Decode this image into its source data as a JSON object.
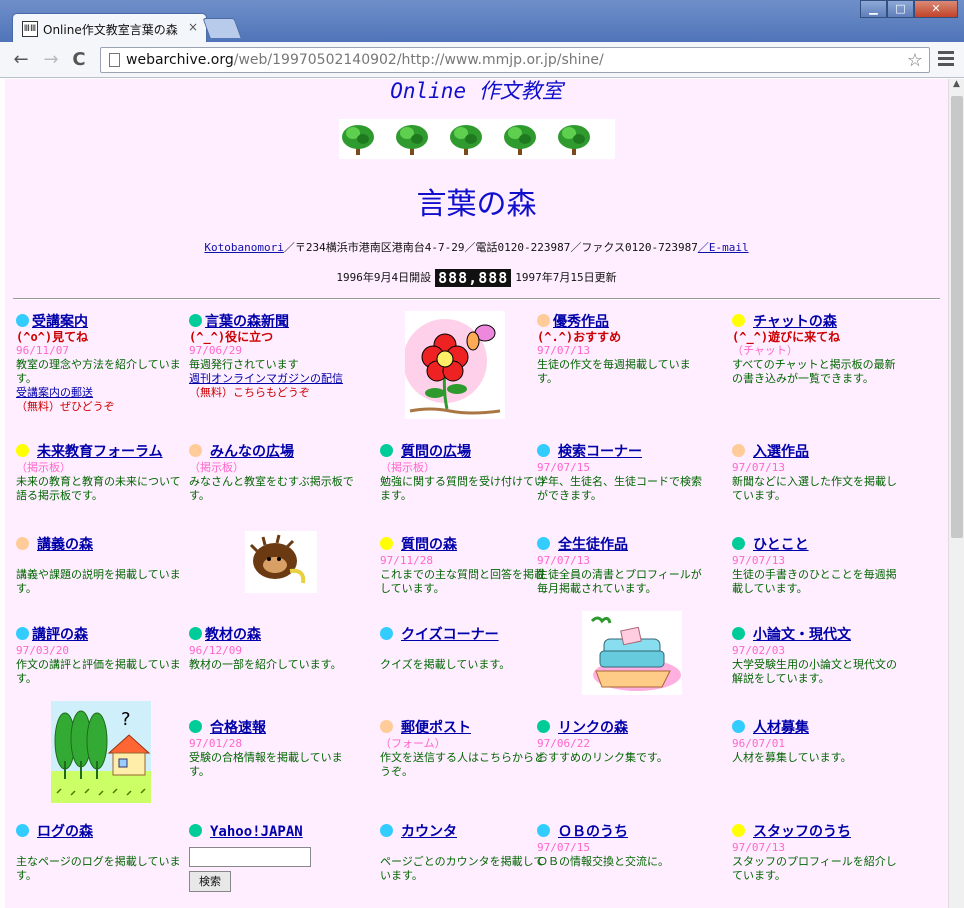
{
  "browser": {
    "tab_title": "Online作文教室言葉の森",
    "tab_close": "×",
    "url_host": "webarchive.org",
    "url_path": "/web/19970502140902/http://www.mmjp.or.jp/shine/",
    "back": "←",
    "forward": "→",
    "reload": "C",
    "star": "☆",
    "min": "▁",
    "max": "□",
    "close": "✕"
  },
  "page": {
    "site_title": "Online 作文教室",
    "main_title": "言葉の森",
    "address_link": "Kotobanomori",
    "address_text": "／〒234横浜市港南区港南台4-7-29／電話0120-223987／ファクス0120-723987",
    "email_link": "／E-mail",
    "opened": "1996年9月4日開設",
    "counter": "888,888",
    "updated": "1997年7月15日更新"
  },
  "colors": {
    "page_bg": "#ffeeff",
    "link": "#0000aa",
    "desc": "#006600",
    "date": "#ff66cc",
    "accent_red": "#cc0000",
    "dot_blue": "#33ccff",
    "dot_green": "#00cc99",
    "dot_peach": "#ffcc99",
    "dot_yellow": "#ffff00"
  },
  "grid": [
    {
      "title": "受講案内",
      "tag": "(^o^)見てね",
      "date": "96/11/07",
      "desc": "教室の理念や方法を紹介しています。",
      "link": "受講案内の郵送",
      "note": "（無料）ぜひどうぞ"
    },
    {
      "title": "言葉の森新聞",
      "tag": "(^_^)役に立つ",
      "date": "97/06/29",
      "desc": "毎週発行されています",
      "link": "週刊オンラインマガジンの配信",
      "note": "（無料）こちらもどうぞ"
    },
    {
      "title": "優秀作品",
      "tag": "(^.^)おすすめ",
      "date": "97/07/13",
      "desc": "生徒の作文を毎週掲載しています。"
    },
    {
      "title": "チャットの森",
      "tag": "(^_^)遊びに来てね",
      "date": "（チャット）",
      "desc": "すべてのチャットと掲示板の最新の書き込みが一覧できます。"
    },
    {
      "title": "未来教育フォーラム",
      "date": "（掲示板）",
      "desc": "未来の教育と教育の未来について語る掲示板です。"
    },
    {
      "title": "みんなの広場",
      "date": "（掲示板）",
      "desc": "みなさんと教室をむすぶ掲示板です。"
    },
    {
      "title": "質問の広場",
      "date": "（掲示板）",
      "desc": "勉強に関する質問を受け付けています。"
    },
    {
      "title": "検索コーナー",
      "date": "97/07/15",
      "desc": "学年、生徒名、生徒コードで検索ができます。"
    },
    {
      "title": "入選作品",
      "date": "97/07/13",
      "desc": "新聞などに入選した作文を掲載しています。"
    },
    {
      "title": "講義の森",
      "desc": "講義や課題の説明を掲載しています。"
    },
    {
      "title": "質問の森",
      "date": "97/11/28",
      "desc": "これまでの主な質問と回答を掲載しています。"
    },
    {
      "title": "全生徒作品",
      "date": "97/07/13",
      "desc": "生徒全員の清書とプロフィールが毎月掲載されています。"
    },
    {
      "title": "ひとこと",
      "date": "97/07/13",
      "desc": "生徒の手書きのひとことを毎週掲載しています。"
    },
    {
      "title": "講評の森",
      "date": "97/03/20",
      "desc": "作文の講評と評価を掲載しています。"
    },
    {
      "title": "教材の森",
      "date": "96/12/09",
      "desc": "教材の一部を紹介しています。"
    },
    {
      "title": "クイズコーナー",
      "desc": "クイズを掲載しています。"
    },
    {
      "title": "小論文・現代文",
      "date": "97/02/03",
      "desc": "大学受験生用の小論文と現代文の解説をしています。"
    },
    {
      "title": "合格速報",
      "date": "97/01/28",
      "desc": "受験の合格情報を掲載しています。"
    },
    {
      "title": "郵便ポスト",
      "date": "（フォーム）",
      "desc": "作文を送信する人はこちらからどうぞ。"
    },
    {
      "title": "リンクの森",
      "date": "97/06/22",
      "desc": "おすすめのリンク集です。"
    },
    {
      "title": "人材募集",
      "date": "96/07/01",
      "desc": "人材を募集しています。"
    },
    {
      "title": "ログの森",
      "desc": "主なページのログを掲載しています。"
    },
    {
      "title": "Yahoo!JAPAN",
      "button": "検索"
    },
    {
      "title": "カウンタ",
      "desc": "ページごとのカウンタを掲載しています。"
    },
    {
      "title": "ＯＢのうち",
      "date": "97/07/15",
      "desc": "ＯＢの情報交換と交流に。"
    },
    {
      "title": "スタッフのうち",
      "date": "97/07/13",
      "desc": "スタッフのプロフィールを紹介しています。"
    }
  ]
}
